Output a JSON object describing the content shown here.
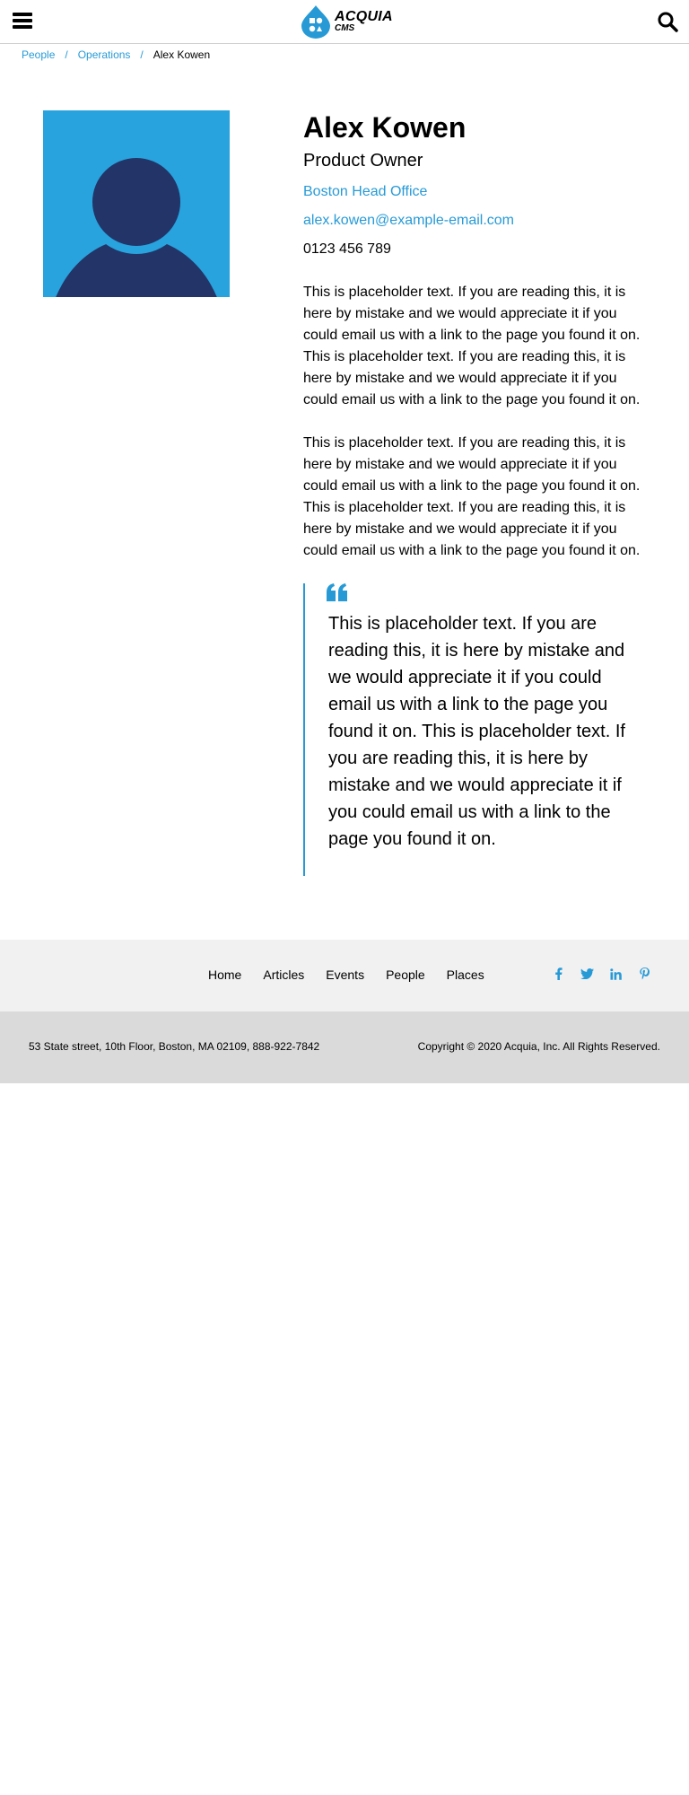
{
  "header": {
    "logo_line1": "ACQUIA",
    "logo_line2": "CMS",
    "menu_icon": "hamburger-menu-icon",
    "search_icon": "search-icon"
  },
  "breadcrumb": {
    "items": [
      "People",
      "Operations"
    ],
    "separator": "/",
    "current": "Alex Kowen"
  },
  "profile": {
    "name": "Alex Kowen",
    "role": "Product Owner",
    "office": "Boston Head Office",
    "email": "alex.kowen@example-email.com",
    "phone": "0123 456 789",
    "paragraphs": [
      "This is placeholder text. If you are reading this, it is here by mistake and we would appreciate it if you could email us with a link to the page you found it on. This is placeholder text. If you are reading this, it is here by mistake and we would appreciate it if you could email us with a link to the page you found it on.",
      "This is placeholder text. If you are reading this, it is here by mistake and we would appreciate it if you could email us with a link to the page you found it on. This is placeholder text. If you are reading this, it is here by mistake and we would appreciate it if you could email us with a link to the page you found it on."
    ]
  },
  "quote": {
    "icon": "quote-icon",
    "text": "This is placeholder text. If you are reading this, it is here by mistake and we would appreciate it if you could email us with a link to the page you found it on. This is placeholder text. If you are reading this, it is here by mistake and we would appreciate it if you could email us with a link to the page you found it on."
  },
  "footer": {
    "nav": [
      "Home",
      "Articles",
      "Events",
      "People",
      "Places"
    ],
    "social_icons": [
      "facebook-icon",
      "twitter-icon",
      "linkedin-icon",
      "pinterest-icon"
    ],
    "address": "53 State street, 10th Floor, Boston, MA 02109, 888-922-7842",
    "copyright": "Copyright © 2020 Acquia, Inc. All Rights Reserved."
  },
  "colors": {
    "accent": "#279ad6",
    "avatar_bg": "#28a3dd",
    "avatar_figure": "#223468",
    "footer_nav_bg": "#f1f1f1",
    "footer_bottom_bg": "#dadada"
  }
}
